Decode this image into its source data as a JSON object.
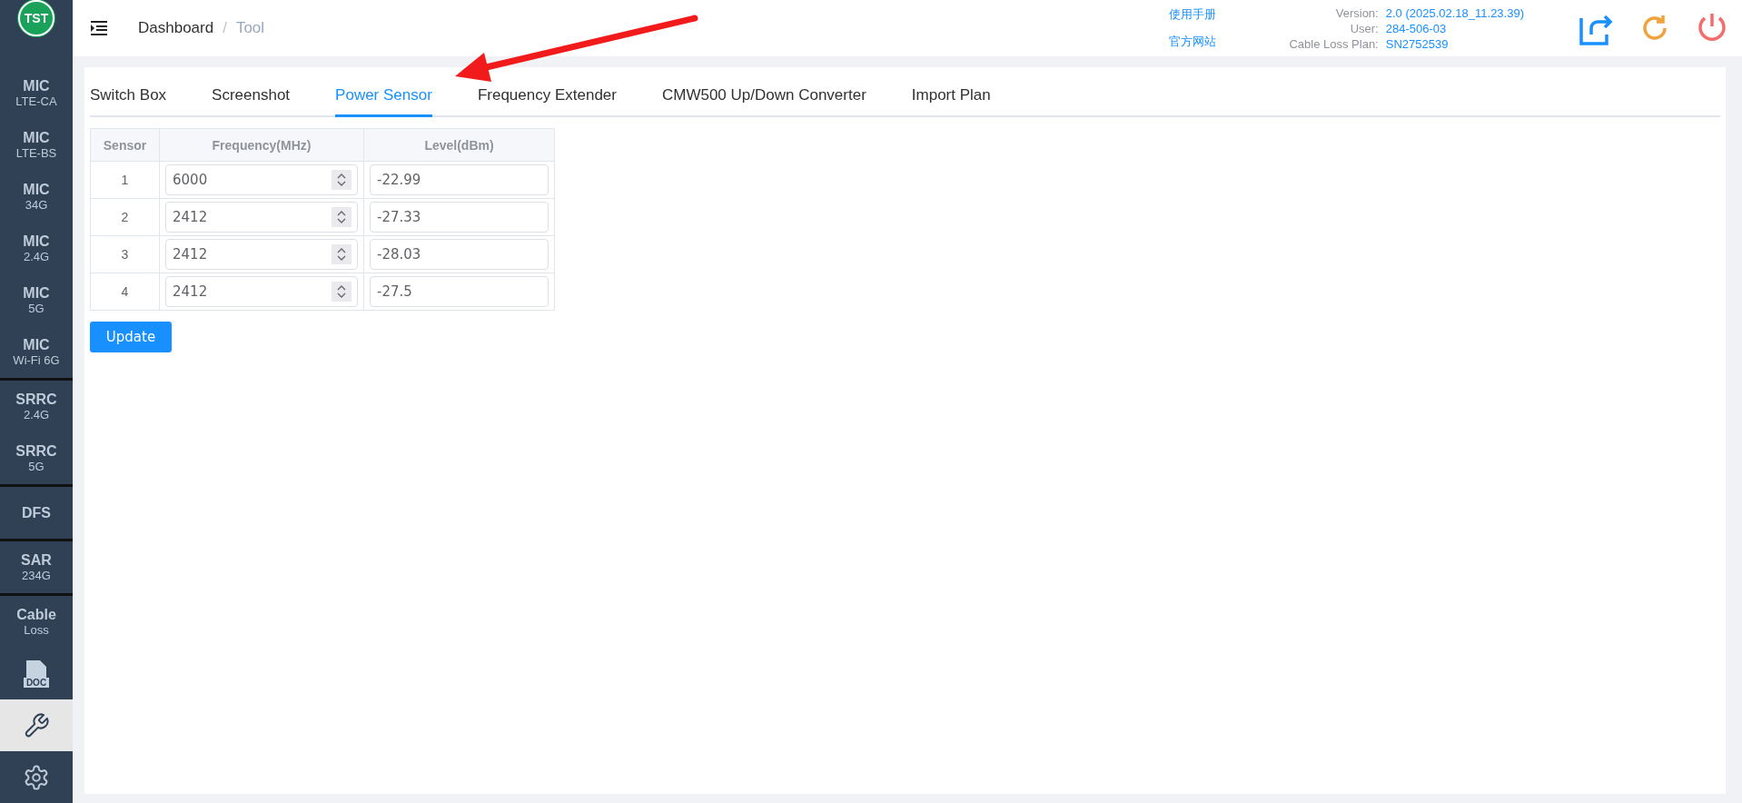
{
  "sidebar": {
    "groups": [
      {
        "items": [
          {
            "kind": "text",
            "title": "MIC",
            "subtitle": "LTE-CA",
            "selected": false
          },
          {
            "kind": "text",
            "title": "MIC",
            "subtitle": "LTE-BS",
            "selected": false
          },
          {
            "kind": "text",
            "title": "MIC",
            "subtitle": "34G",
            "selected": false
          },
          {
            "kind": "text",
            "title": "MIC",
            "subtitle": "2.4G",
            "selected": false
          },
          {
            "kind": "text",
            "title": "MIC",
            "subtitle": "5G",
            "selected": false
          },
          {
            "kind": "text",
            "title": "MIC",
            "subtitle": "Wi-Fi 6G",
            "selected": false
          }
        ]
      },
      {
        "items": [
          {
            "kind": "text",
            "title": "SRRC",
            "subtitle": "2.4G",
            "selected": false
          },
          {
            "kind": "text",
            "title": "SRRC",
            "subtitle": "5G",
            "selected": false
          }
        ]
      },
      {
        "items": [
          {
            "kind": "text",
            "title": "DFS",
            "selected": false
          }
        ]
      },
      {
        "items": [
          {
            "kind": "text",
            "title": "SAR",
            "subtitle": "234G",
            "selected": false
          }
        ]
      },
      {
        "items": [
          {
            "kind": "text",
            "title": "Cable",
            "subtitle": "Loss",
            "selected": false
          },
          {
            "kind": "doc",
            "label": "DOC",
            "selected": false
          },
          {
            "kind": "tool",
            "selected": true
          },
          {
            "kind": "settings",
            "selected": false
          }
        ]
      }
    ]
  },
  "header": {
    "logo": "TST",
    "breadcrumb": [
      "Dashboard",
      "Tool"
    ],
    "breadcrumb_separator": "/",
    "links": [
      "使用手册",
      "官方网站"
    ],
    "info": [
      {
        "label": "Version:",
        "value": "2.0 (2025.02.18_11.23.39)"
      },
      {
        "label": "User:",
        "value": "284-506-03"
      },
      {
        "label": "Cable Loss Plan:",
        "value": "SN2752539"
      }
    ]
  },
  "tabs": [
    {
      "label": "Switch Box",
      "selected": false
    },
    {
      "label": "Screenshot",
      "selected": false
    },
    {
      "label": "Power Sensor",
      "selected": true
    },
    {
      "label": "Frequency Extender",
      "selected": false
    },
    {
      "label": "CMW500 Up/Down Converter",
      "selected": false
    },
    {
      "label": "Import Plan",
      "selected": false
    }
  ],
  "table": {
    "columns": [
      "Sensor",
      "Frequency(MHz)",
      "Level(dBm)"
    ],
    "rows": [
      {
        "sensor": "1",
        "frequency": "6000",
        "level": "-22.99"
      },
      {
        "sensor": "2",
        "frequency": "2412",
        "level": "-27.33"
      },
      {
        "sensor": "3",
        "frequency": "2412",
        "level": "-28.03"
      },
      {
        "sensor": "4",
        "frequency": "2412",
        "level": "-27.5"
      }
    ]
  },
  "update_button": "Update"
}
